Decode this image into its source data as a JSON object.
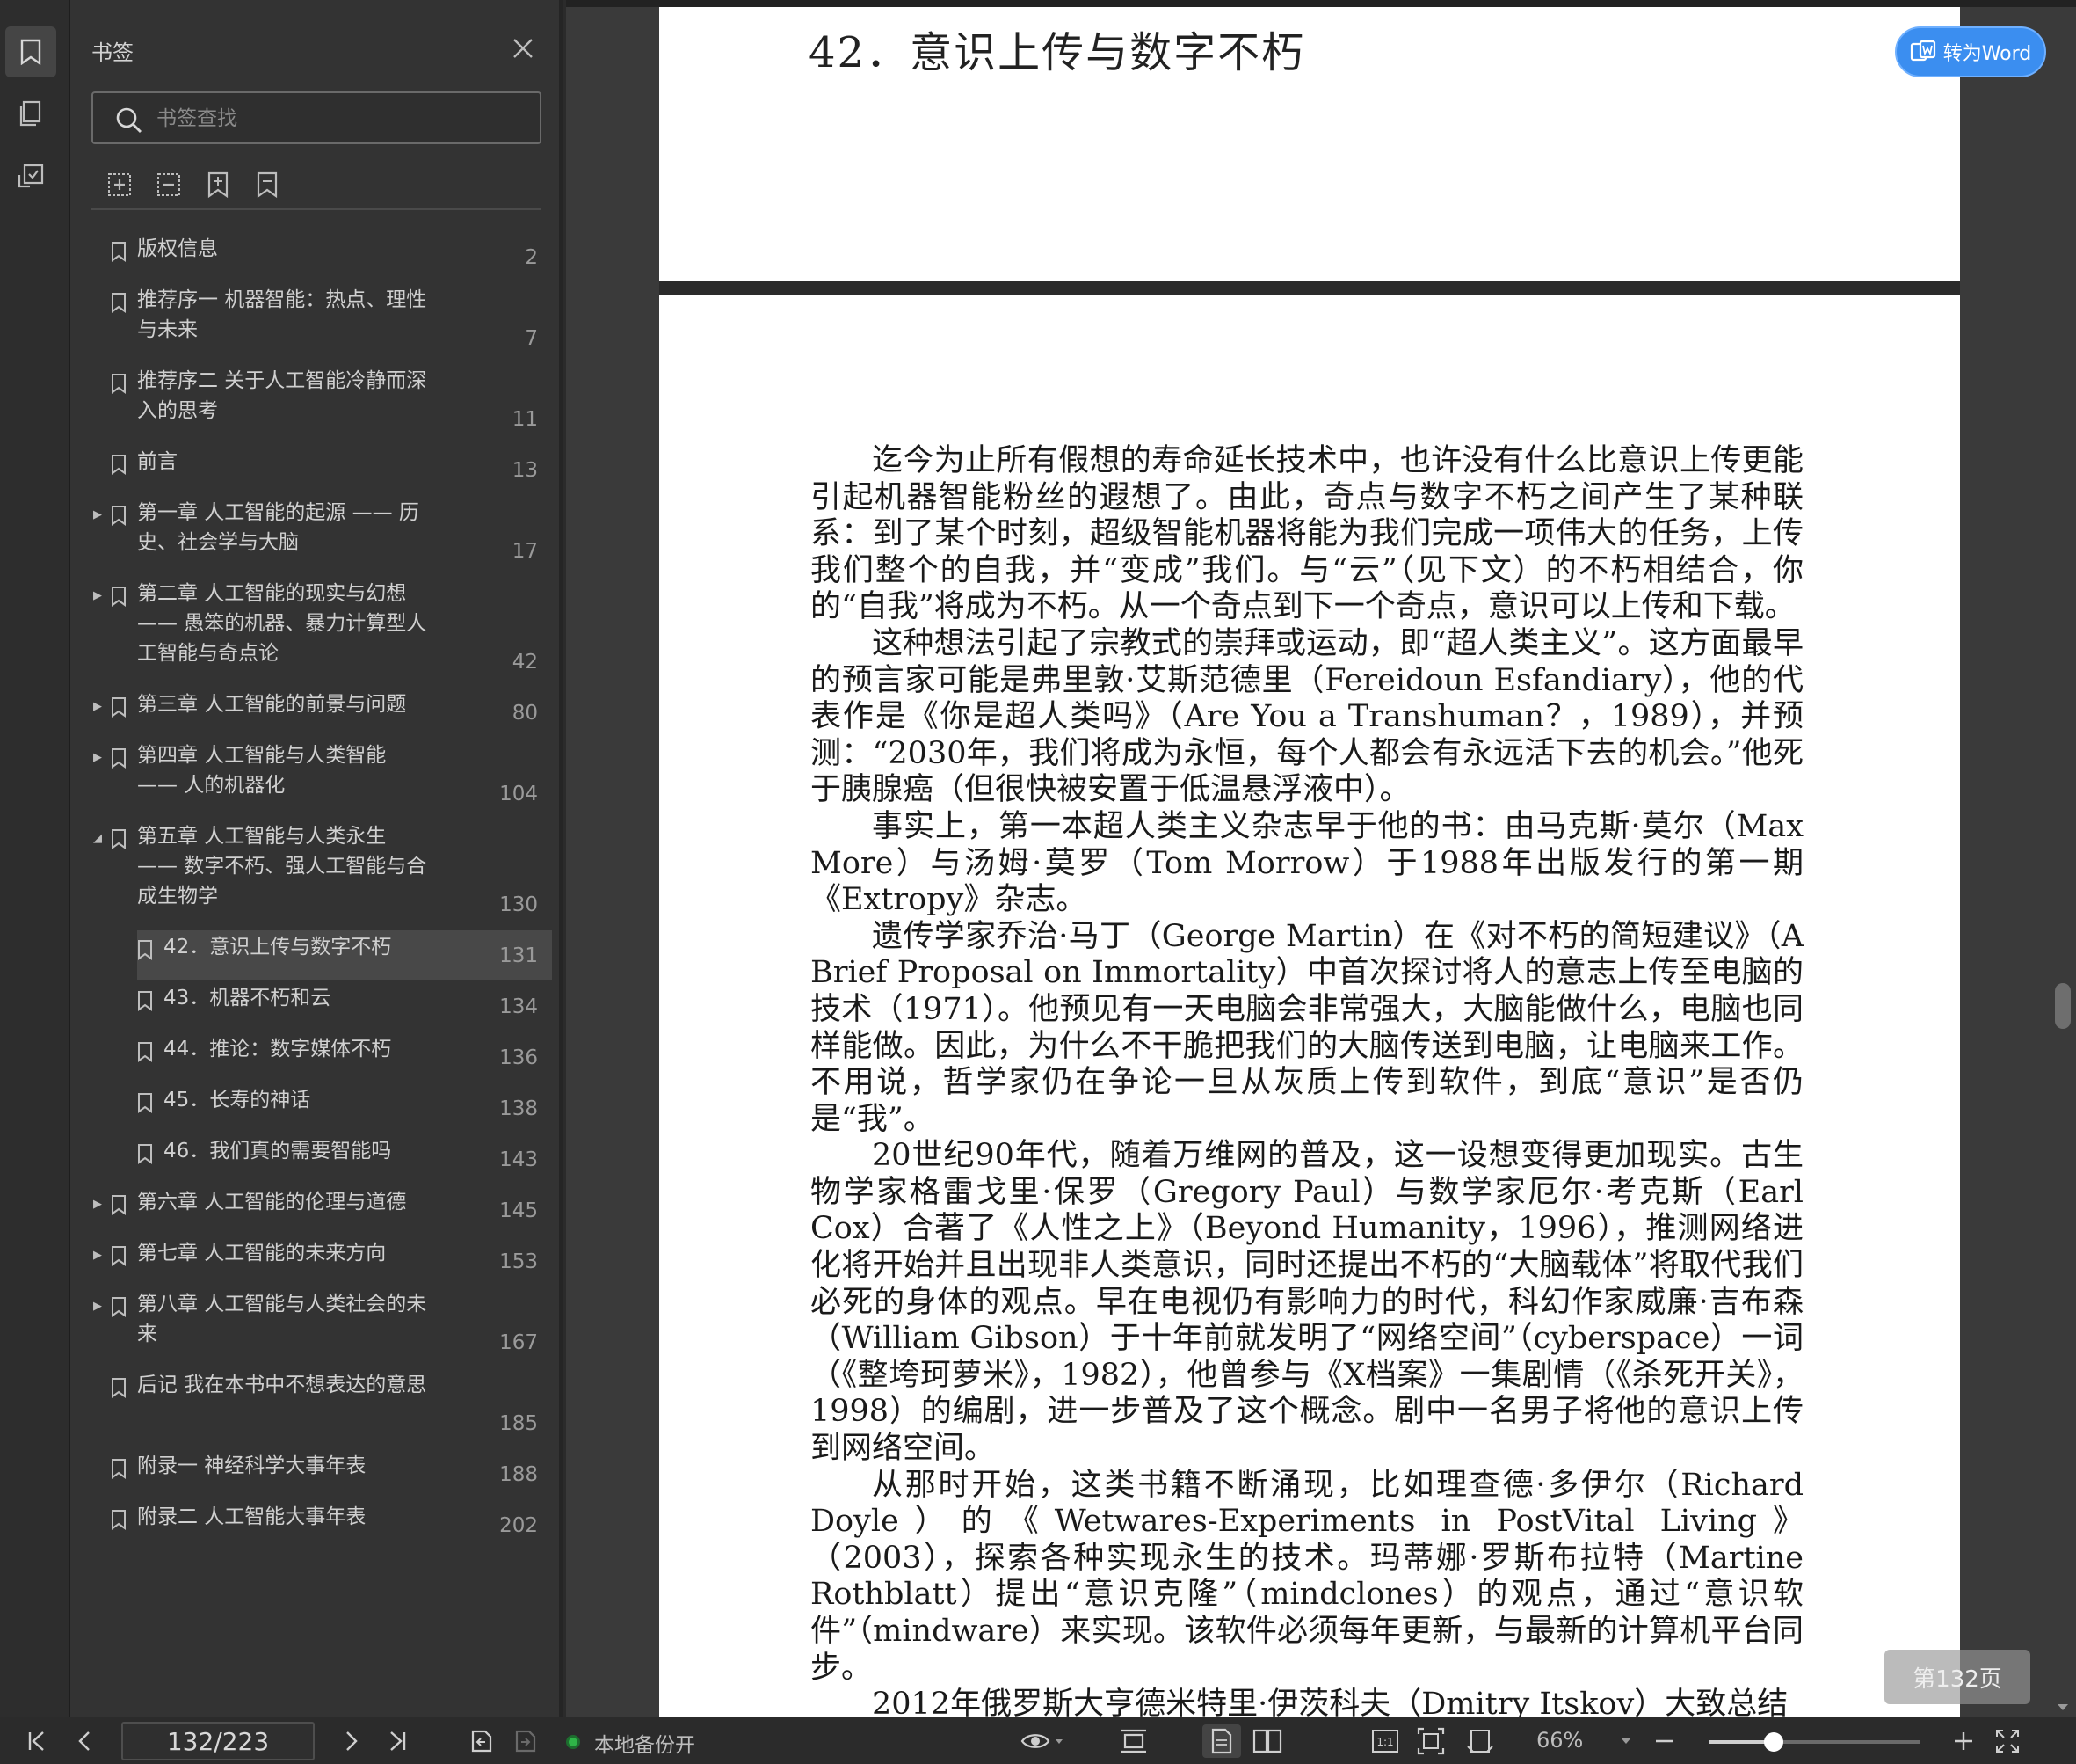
{
  "panel": {
    "title": "书签",
    "search_placeholder": "书签查找"
  },
  "bookmarks": [
    {
      "title": "版权信息",
      "page": "2"
    },
    {
      "title": "推荐序一 机器智能：热点、理性与未来",
      "page": "7"
    },
    {
      "title": "推荐序二 关于人工智能冷静而深入的思考",
      "page": "11"
    },
    {
      "title": "前言",
      "page": "13"
    },
    {
      "title": "第一章 人工智能的起源 —— 历史、社会学与大脑",
      "page": "17"
    },
    {
      "title": "第二章 人工智能的现实与幻想 —— 愚笨的机器、暴力计算型人工智能与奇点论",
      "page": "42"
    },
    {
      "title": "第三章  人工智能的前景与问题",
      "page": "80"
    },
    {
      "title": "第四章 人工智能与人类智能 —— 人的机器化",
      "page": "104"
    },
    {
      "title": "第五章 人工智能与人类永生 —— 数字不朽、强人工智能与合成生物学",
      "page": "130"
    },
    {
      "title": "42．意识上传与数字不朽",
      "page": "131"
    },
    {
      "title": "43．机器不朽和云",
      "page": "134"
    },
    {
      "title": "44．推论：数字媒体不朽",
      "page": "136"
    },
    {
      "title": "45．长寿的神话",
      "page": "138"
    },
    {
      "title": "46．我们真的需要智能吗",
      "page": "143"
    },
    {
      "title": "第六章 人工智能的伦理与道德",
      "page": "145"
    },
    {
      "title": "第七章 人工智能的未来方向",
      "page": "153"
    },
    {
      "title": "第八章 人工智能与人类社会的未来",
      "page": "167"
    },
    {
      "title": "后记 我在本书中不想表达的意思",
      "page": "185"
    },
    {
      "title": "附录一 神经科学大事年表",
      "page": "188"
    },
    {
      "title": "附录二 人工智能大事年表",
      "page": "202"
    }
  ],
  "document": {
    "heading": "42．意识上传与数字不朽",
    "paragraphs": [
      "迄今为止所有假想的寿命延长技术中，也许没有什么比意识上传更能引起机器智能粉丝的遐想了。由此，奇点与数字不朽之间产生了某种联系：到了某个时刻，超级智能机器将能为我们完成一项伟大的任务，上传我们整个的自我，并“变成”我们。与“云”（见下文）的不朽相结合，你的“自我”将成为不朽。从一个奇点到下一个奇点，意识可以上传和下载。",
      "这种想法引起了宗教式的崇拜或运动，即“超人类主义”。这方面最早的预言家可能是弗里敦·艾斯范德里（Fereidoun Esfandiary），他的代表作是《你是超人类吗》（Are You a Transhuman？，1989），并预测：“2030年，我们将成为永恒，每个人都会有永远活下去的机会。”他死于胰腺癌（但很快被安置于低温悬浮液中）。",
      "事实上，第一本超人类主义杂志早于他的书：由马克斯·莫尔（Max More）与汤姆·莫罗（Tom Morrow）于1988年出版发行的第一期《Extropy》杂志。",
      "遗传学家乔治·马丁（George Martin）在《对不朽的简短建议》（A Brief Proposal on Immortality）中首次探讨将人的意志上传至电脑的技术（1971）。他预见有一天电脑会非常强大，大脑能做什么，电脑也同样能做。因此，为什么不干脆把我们的大脑传送到电脑，让电脑来工作。不用说，哲学家仍在争论一旦从灰质上传到软件，到底“意识”是否仍是“我”。",
      "20世纪90年代，随着万维网的普及，这一设想变得更加现实。古生物学家格雷戈里·保罗（Gregory Paul）与数学家厄尔·考克斯（Earl Cox）合著了《人性之上》（Beyond Humanity，1996），推测网络进化将开始并且出现非人类意识，同时还提出不朽的“大脑载体”将取代我们必死的身体的观点。早在电视仍有影响力的时代，科幻作家威廉·吉布森（William Gibson）于十年前就发明了“网络空间”（cyberspace）一词（《整垮珂萝米》，1982），他曾参与《X档案》一集剧情（《杀死开关》，1998）的编剧，进一步普及了这个概念。剧中一名男子将他的意识上传到网络空间。",
      "从那时开始，这类书籍不断涌现，比如理查德·多伊尔（Richard Doyle）的《Wetwares-Experiments in PostVital Living》（2003），探索各种实现永生的技术。玛蒂娜·罗斯布拉特（Martine Rothblatt）提出“意识克隆”（mindclones）的观点，通过“意识软件”（mindware）来实现。该软件必须每年更新，与最新的计算机平台同步。",
      "2012年俄罗斯大亨德米特里·伊茨科夫（Dmitry Itskov）大致总结"
    ]
  },
  "buttons": {
    "to_word": "转为Word",
    "page_badge": "第132页"
  },
  "status": {
    "page_field": "132/223",
    "backup": "本地备份开",
    "zoom": "66%",
    "zoom_fraction": 0.31
  }
}
